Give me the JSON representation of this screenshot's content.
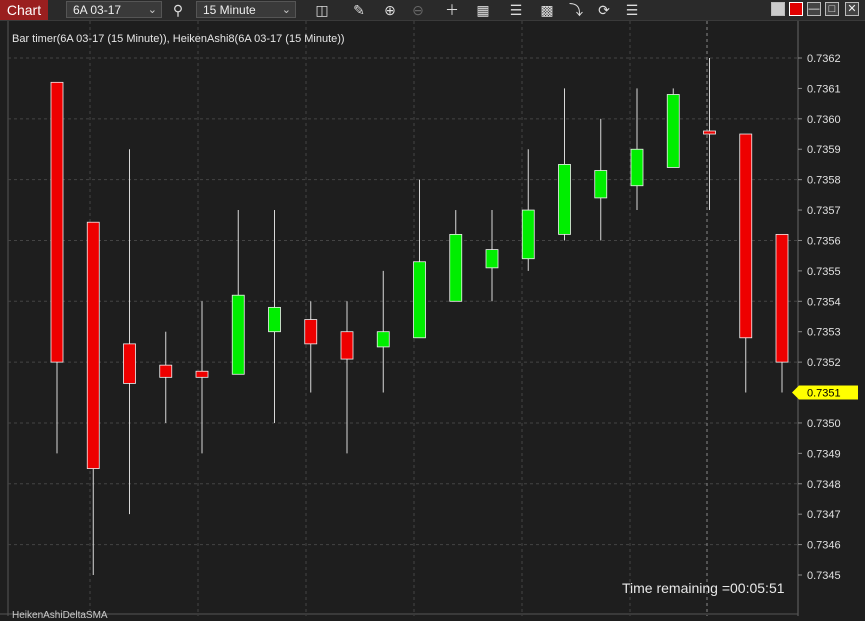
{
  "toolbar": {
    "chart_tab": "Chart",
    "instrument": "6A 03-17",
    "timeframe": "15 Minute"
  },
  "indicator_label": "Bar timer(6A 03-17 (15 Minute)), HeikenAshi8(6A 03-17 (15 Minute))",
  "time_remaining": "Time remaining =00:05:51",
  "lower_panel_label": "HeikenAshiDeltaSMA",
  "colors": {
    "up": "#00ee00",
    "down": "#ee0000",
    "price_marker": "#ffff00",
    "background": "#1e1e1e",
    "grid": "#444444"
  },
  "icons": [
    "bar-style-icon",
    "pencil-icon",
    "zoom-in-icon",
    "zoom-out-icon",
    "crosshair-icon",
    "data-box-icon",
    "strategy-icon",
    "indicator-icon",
    "drawing-tools-icon",
    "refresh-icon",
    "properties-icon"
  ],
  "chart_data": {
    "type": "candlestick",
    "y_ticks": [
      "0.7362",
      "0.7361",
      "0.7360",
      "0.7359",
      "0.7358",
      "0.7357",
      "0.7356",
      "0.7355",
      "0.7354",
      "0.7353",
      "0.7352",
      "0.7350",
      "0.7349",
      "0.7348",
      "0.7347",
      "0.7346",
      "0.7345"
    ],
    "ylim": [
      0.73444,
      0.73634
    ],
    "last_price": "0.7351",
    "candles": [
      {
        "open": 0.73612,
        "close": 0.7352,
        "high": 0.73612,
        "low": 0.7349
      },
      {
        "open": 0.73566,
        "close": 0.73485,
        "high": 0.73566,
        "low": 0.7345
      },
      {
        "open": 0.73526,
        "close": 0.73513,
        "high": 0.7359,
        "low": 0.7347
      },
      {
        "open": 0.73519,
        "close": 0.73515,
        "high": 0.7353,
        "low": 0.735
      },
      {
        "open": 0.73517,
        "close": 0.73515,
        "high": 0.7354,
        "low": 0.7349
      },
      {
        "open": 0.73516,
        "close": 0.73542,
        "high": 0.7357,
        "low": 0.73516
      },
      {
        "open": 0.7353,
        "close": 0.73538,
        "high": 0.7357,
        "low": 0.735
      },
      {
        "open": 0.73534,
        "close": 0.73526,
        "high": 0.7354,
        "low": 0.7351
      },
      {
        "open": 0.7353,
        "close": 0.73521,
        "high": 0.7354,
        "low": 0.7349
      },
      {
        "open": 0.73525,
        "close": 0.7353,
        "high": 0.7355,
        "low": 0.7351
      },
      {
        "open": 0.73528,
        "close": 0.73553,
        "high": 0.7358,
        "low": 0.73528
      },
      {
        "open": 0.7354,
        "close": 0.73562,
        "high": 0.7357,
        "low": 0.7354
      },
      {
        "open": 0.73551,
        "close": 0.73557,
        "high": 0.7357,
        "low": 0.7354
      },
      {
        "open": 0.73554,
        "close": 0.7357,
        "high": 0.7359,
        "low": 0.7355
      },
      {
        "open": 0.73562,
        "close": 0.73585,
        "high": 0.7361,
        "low": 0.7356
      },
      {
        "open": 0.73574,
        "close": 0.73583,
        "high": 0.736,
        "low": 0.7356
      },
      {
        "open": 0.73578,
        "close": 0.7359,
        "high": 0.7361,
        "low": 0.7357
      },
      {
        "open": 0.73584,
        "close": 0.73608,
        "high": 0.7361,
        "low": 0.73584
      },
      {
        "open": 0.73596,
        "close": 0.73595,
        "high": 0.7362,
        "low": 0.7357
      },
      {
        "open": 0.73595,
        "close": 0.73528,
        "high": 0.73595,
        "low": 0.7351
      },
      {
        "open": 0.73562,
        "close": 0.7352,
        "high": 0.73562,
        "low": 0.7351
      }
    ]
  }
}
